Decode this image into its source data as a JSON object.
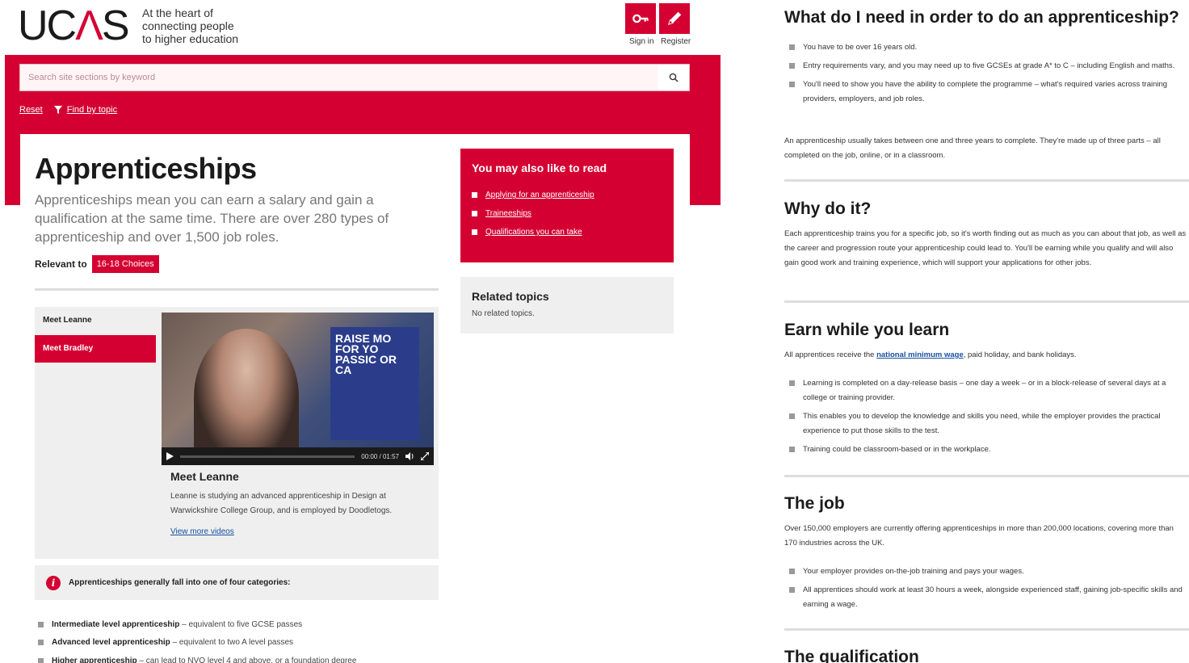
{
  "header": {
    "logo_text": "UCAS",
    "tagline": [
      "At the heart of",
      "connecting people",
      "to higher education"
    ],
    "sign_in_label": "Sign in",
    "register_label": "Register"
  },
  "search": {
    "placeholder": "Search site sections by keyword"
  },
  "tools": {
    "reset_label": "Reset",
    "find_by_topic_label": "Find by topic"
  },
  "page": {
    "title": "Apprenticeships",
    "intro": "Apprenticeships mean you can earn a salary and gain a qualification at the same time. There are over 280 types of apprenticeship and over 1,500 job roles.",
    "relevant_label": "Relevant to",
    "relevant_badge": "16-18 Choices"
  },
  "video_panel": {
    "tabs": [
      "Meet Leanne",
      "Meet Bradley"
    ],
    "active_tab": "Meet Bradley",
    "poster_text": "RAISE MO FOR YO PASSIC OR CA",
    "time": "00:00 / 01:57",
    "name": "Meet Leanne",
    "description": "Leanne is studying an advanced apprenticeship in Design at Warwickshire College Group, and is employed by Doodletogs.",
    "more_link": "View more videos"
  },
  "info_box": {
    "text": "Apprenticeships generally fall into one of four categories:"
  },
  "categories": [
    {
      "bold": "Intermediate level apprenticeship",
      "rest": " – equivalent to five GCSE passes"
    },
    {
      "bold": "Advanced level apprenticeship",
      "rest": " – equivalent to two A level passes"
    },
    {
      "bold": "Higher apprenticeship",
      "rest": " – can lead to NVQ level 4 and above, or a foundation degree"
    }
  ],
  "also_read": {
    "title": "You may also like to read",
    "links": [
      "Applying for an apprenticeship",
      "Traineeships",
      "Qualifications you can take"
    ]
  },
  "related_topics": {
    "title": "Related topics",
    "text": "No related topics."
  },
  "right": {
    "need_title": "What do I need in order to do an apprenticeship?",
    "need_items": [
      "You have to be over 16 years old.",
      "Entry requirements vary, and you may need up to five GCSEs at grade A* to C – including English and maths.",
      "You'll need to show you have the ability to complete the programme – what's required varies across training providers, employers, and job roles."
    ],
    "need_para": "An apprenticeship usually takes between one and three years to complete. They're made up of three parts – all completed on the job, online, or in a classroom.",
    "why_title": "Why do it?",
    "why_para": "Each apprenticeship trains you for a specific job, so it's worth finding out as much as you can about that job, as well as the career and progression route your apprenticeship could lead to. You'll be earning while you qualify and will also gain good work and training experience, which will support your applications for other jobs.",
    "earn_title": "Earn while you learn",
    "earn_intro_before": "All apprentices receive the ",
    "earn_intro_link": "national minimum wage",
    "earn_intro_after": ", paid holiday, and bank holidays.",
    "earn_items": [
      "Learning is completed on a day-release basis – one day a week – or in a block-release of several days at a college or training provider.",
      "This enables you to develop the knowledge and skills you need, while the employer provides the practical experience to put those skills to the test.",
      "Training could be classroom-based or in the workplace."
    ],
    "job_title": "The job",
    "job_para": "Over 150,000 employers are currently offering apprenticeships in more than 200,000 locations, covering more than 170 industries across the UK.",
    "job_items": [
      "Your employer provides on-the-job training and pays your wages.",
      "All apprentices should work at least 30 hours a week, alongside experienced staff, gaining job-specific skills and earning a wage."
    ],
    "qual_title": "The qualification"
  }
}
